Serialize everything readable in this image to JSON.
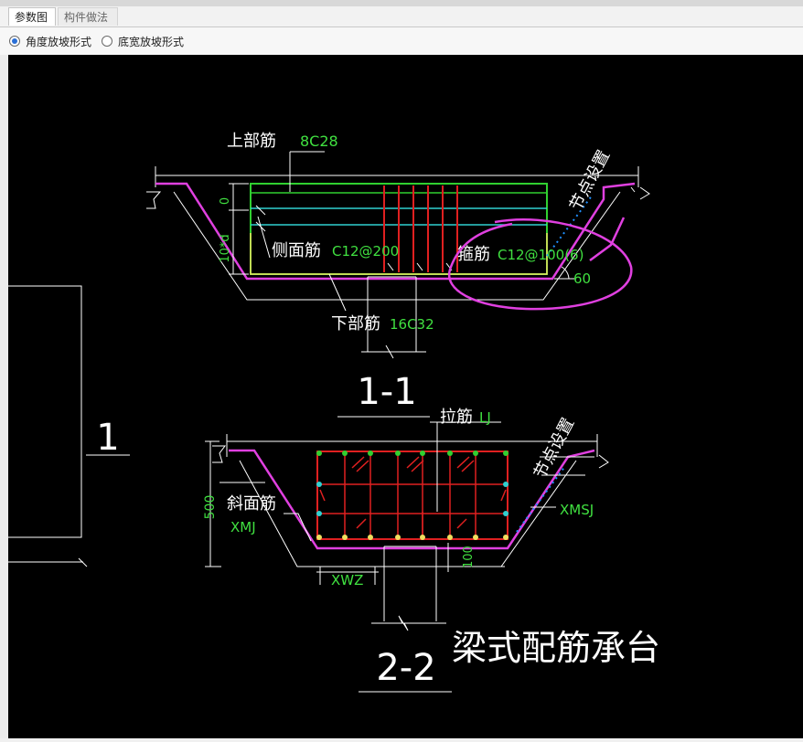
{
  "tabs": [
    {
      "label": "参数图"
    },
    {
      "label": "构件做法"
    }
  ],
  "options": [
    {
      "label": "角度放坡形式",
      "selected": true
    },
    {
      "label": "底宽放坡形式",
      "selected": false
    }
  ],
  "drawing": {
    "colors": {
      "background": "#000000",
      "line": "#ffffff",
      "cap_edge": "#e040e0",
      "rebar_outline": "#30d030",
      "rebar_red": "#e02020",
      "side_rebar": "#30d0d0",
      "dim_yellow": "#f0e060",
      "label_green": "#40e040",
      "node_dotted": "#2090ff",
      "annotation": "#e040e0"
    },
    "section1": {
      "title": "1-1",
      "top_bar_label": "上部筋",
      "top_bar_value": "8C28",
      "side_bar_label": "侧面筋",
      "side_bar_value": "C12@200",
      "stirrup_label": "箍筋",
      "stirrup_value": "C12@100(6)",
      "bottom_bar_label": "下部筋",
      "bottom_bar_value": "16C32",
      "node_label": "节点设置",
      "angle_value": "60",
      "dim_zero": "0",
      "dim_height": "10*d"
    },
    "section2": {
      "title": "2-2",
      "tie_label": "拉筋",
      "tie_value": "LJ",
      "slope_label": "斜面筋",
      "slope_value": "XMJ",
      "node_label": "节点设置",
      "xmsj": "XMSJ",
      "xwz": "XWZ",
      "dim_500": "500",
      "dim_100": "100"
    },
    "caption": "梁式配筋承台",
    "left_label": "1"
  }
}
